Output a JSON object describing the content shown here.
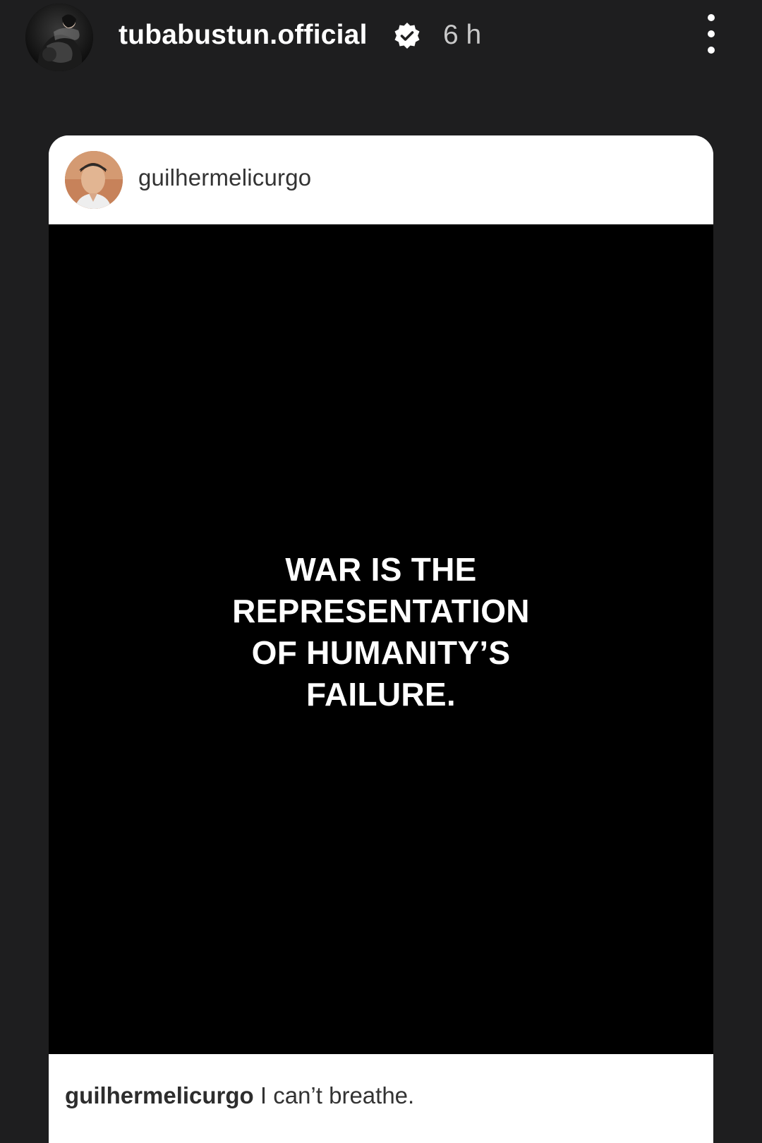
{
  "story": {
    "username": "tubabustun.official",
    "time": "6 h",
    "verified": true
  },
  "shared_post": {
    "username": "guilhermelicurgo",
    "quote_lines": [
      "WAR IS THE",
      "REPRESENTATION",
      "OF HUMANITY’S",
      "FAILURE."
    ],
    "caption_username": "guilhermelicurgo",
    "caption_text": "I can’t breathe."
  },
  "colors": {
    "background": "#1e1e1f",
    "card": "#ffffff",
    "post_image": "#000000",
    "text_primary": "#ffffff",
    "text_secondary": "#c9c9c9"
  },
  "icons": {
    "verified": "verified-badge-icon",
    "more": "more-vertical-icon"
  }
}
